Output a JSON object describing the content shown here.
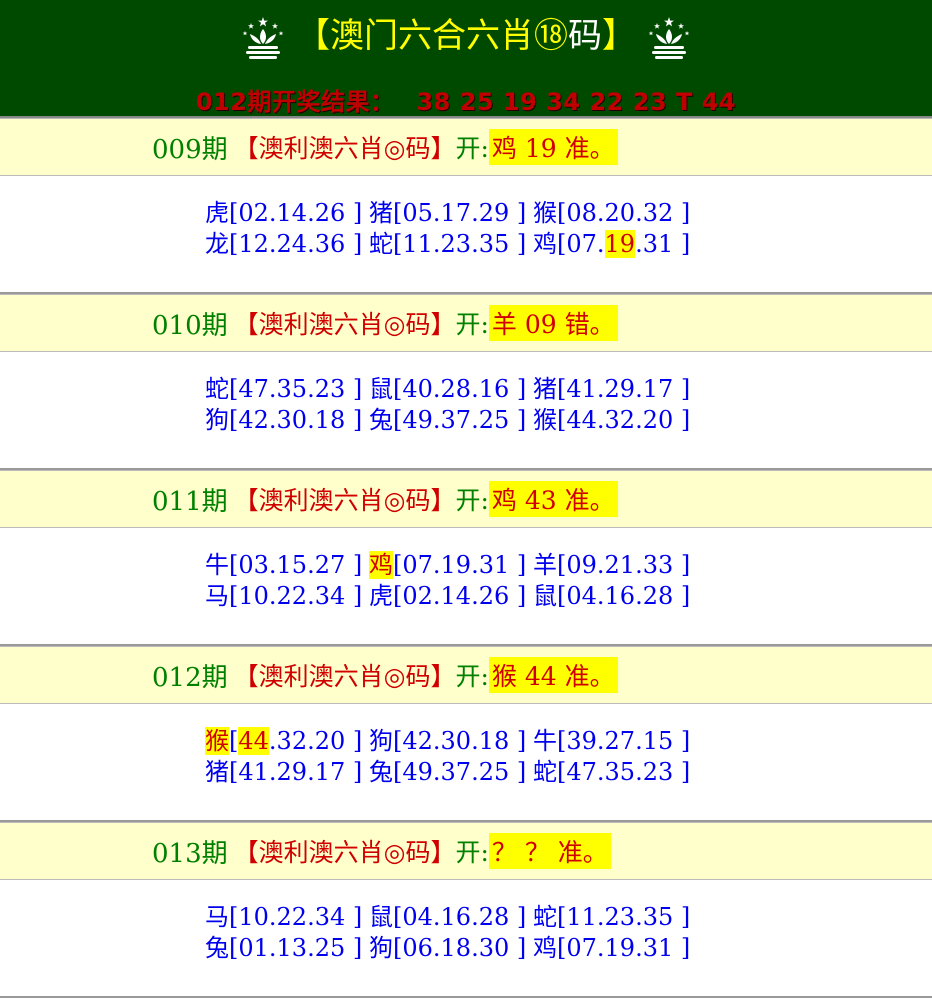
{
  "header": {
    "title_part1": "【澳门六合",
    "title_part2": "六肖⑱",
    "title_part3": "码",
    "title_part4": "】",
    "result_label": "012期开奖结果：",
    "result_numbers": "38 25 19 34 22 23 T 44"
  },
  "periods": [
    {
      "label": "009期",
      "brand": "【澳利澳六肖◎码】",
      "open_label": "开:",
      "open_value": "鸡 19 准。",
      "rows": [
        [
          {
            "z": "虎",
            "n": "[02.14.26 ]"
          },
          {
            "z": "猪",
            "n": "[05.17.29 ]"
          },
          {
            "z": "猴",
            "n": "[08.20.32 ]"
          }
        ],
        [
          {
            "z": "龙",
            "n": "[12.24.36 ]"
          },
          {
            "z": "蛇",
            "n": "[11.23.35 ]"
          },
          {
            "z": "鸡",
            "n": "[07.",
            "hl": "19",
            "tail": ".31 ]"
          }
        ]
      ]
    },
    {
      "label": "010期",
      "brand": "【澳利澳六肖◎码】",
      "open_label": "开:",
      "open_value": "羊 09 错。",
      "rows": [
        [
          {
            "z": "蛇",
            "n": "[47.35.23 ]"
          },
          {
            "z": "鼠",
            "n": "[40.28.16 ]"
          },
          {
            "z": "猪",
            "n": "[41.29.17 ]"
          }
        ],
        [
          {
            "z": "狗",
            "n": "[42.30.18 ]"
          },
          {
            "z": "兔",
            "n": "[49.37.25 ]"
          },
          {
            "z": "猴",
            "n": "[44.32.20 ]"
          }
        ]
      ]
    },
    {
      "label": "011期",
      "brand": "【澳利澳六肖◎码】",
      "open_label": "开:",
      "open_value": "鸡 43 准。",
      "rows": [
        [
          {
            "z": "牛",
            "n": "[03.15.27 ]"
          },
          {
            "z": "鸡",
            "n": "[07.19.31 ]",
            "zhl": true
          },
          {
            "z": "羊",
            "n": "[09.21.33 ]"
          }
        ],
        [
          {
            "z": "马",
            "n": "[10.22.34 ]"
          },
          {
            "z": "虎",
            "n": "[02.14.26 ]"
          },
          {
            "z": "鼠",
            "n": "[04.16.28 ]"
          }
        ]
      ]
    },
    {
      "label": "012期",
      "brand": "【澳利澳六肖◎码】",
      "open_label": "开:",
      "open_value": "猴 44 准。",
      "rows": [
        [
          {
            "z": "猴",
            "n": "[",
            "hl": "44",
            "tail": ".32.20 ]",
            "zhl": true
          },
          {
            "z": "狗",
            "n": "[42.30.18 ]"
          },
          {
            "z": "牛",
            "n": "[39.27.15 ]"
          }
        ],
        [
          {
            "z": "猪",
            "n": "[41.29.17 ]"
          },
          {
            "z": "兔",
            "n": "[49.37.25 ]"
          },
          {
            "z": "蛇",
            "n": "[47.35.23 ]"
          }
        ]
      ]
    },
    {
      "label": "013期",
      "brand": "【澳利澳六肖◎码】",
      "open_label": "开:",
      "open_value": " ？ ？ 准。",
      "rows": [
        [
          {
            "z": "马",
            "n": "[10.22.34 ]"
          },
          {
            "z": "鼠",
            "n": "[04.16.28 ]"
          },
          {
            "z": "蛇",
            "n": "[11.23.35 ]"
          }
        ],
        [
          {
            "z": "兔",
            "n": "[01.13.25 ]"
          },
          {
            "z": "狗",
            "n": "[06.18.30 ]"
          },
          {
            "z": "鸡",
            "n": "[07.19.31 ]"
          }
        ]
      ]
    }
  ],
  "colors": {
    "header_bg": "#004a00",
    "period_green": "#008000",
    "brand_red": "#d00000",
    "highlight": "#ffff00",
    "number_blue": "#0000ee"
  },
  "icons": {
    "emblem": "macau-lotus-emblem-icon"
  }
}
